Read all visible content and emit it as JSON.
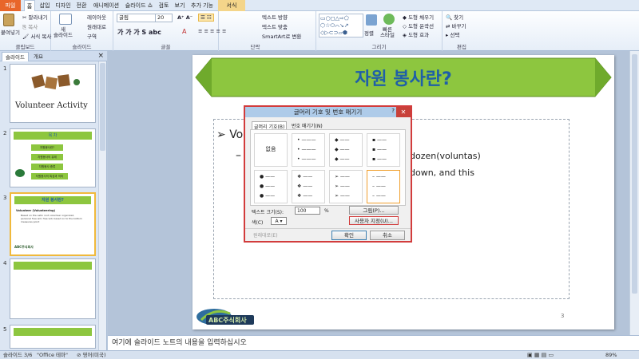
{
  "tabs": [
    {
      "label": "파일",
      "kind": "file"
    },
    {
      "label": "홈",
      "kind": "active"
    },
    {
      "label": "삽입",
      "kind": ""
    },
    {
      "label": "디자인",
      "kind": ""
    },
    {
      "label": "전환",
      "kind": ""
    },
    {
      "label": "애니메이션",
      "kind": ""
    },
    {
      "label": "슬라이드 쇼",
      "kind": ""
    },
    {
      "label": "검토",
      "kind": ""
    },
    {
      "label": "보기",
      "kind": ""
    },
    {
      "label": "추가 기능",
      "kind": ""
    },
    {
      "label": "서식",
      "kind": "context"
    }
  ],
  "ribbon": {
    "paste": "붙여넣기",
    "cut": "잘라내기",
    "copy": "복사",
    "format_painter": "서식 복사",
    "clipboard": "클립보드",
    "new_slide": "새\n슬라이드",
    "layout": "레이아웃",
    "reset": "원래대로",
    "section": "구역",
    "slides": "슬라이드",
    "font_name": "굴림",
    "font_size": "20",
    "font": "글꼴",
    "text_direction": "텍스트 방향",
    "align_text": "텍스트 맞춤",
    "smartart": "SmartArt로 변환",
    "paragraph": "단락",
    "arrange": "정렬",
    "quick_styles": "빠른\n스타일",
    "shape_fill": "도형 채우기",
    "shape_outline": "도형 윤곽선",
    "shape_effects": "도형 효과",
    "drawing": "그리기",
    "find": "찾기",
    "replace": "바꾸기",
    "select": "선택",
    "editing": "편집"
  },
  "left_panel": {
    "tab_slides": "슬라이드",
    "tab_outline": "개요",
    "close": "×",
    "slide_numbers": [
      "1",
      "2",
      "3",
      "4",
      "5"
    ],
    "thumb1_title": "Volunteer Activity",
    "thumb2_title": "목 차",
    "thumb2_items": [
      "자원봉사란?",
      "자원봉사의 유래",
      "자원봉사 종류",
      "자원봉사의 특성과 의미"
    ],
    "thumb3_title": "자원 봉사란?",
    "thumb3_bullet": "Volunteer (Volunteering)",
    "thumb3_sub": "Based on the Latin root volunteer organized, personal free will, free will, based on to the bottom measures point",
    "logo_text": "ABC주식회사"
  },
  "slide": {
    "title": "자원 봉사란?",
    "bullet_partial": "Vo",
    "sub_text1": "dozen(voluntas)",
    "sub_text2": "down, and this",
    "page_number": "3",
    "logo_text": "ABC주식회사"
  },
  "dialog": {
    "title": "글머리 기호 및 번호 매기기",
    "help": "?",
    "tab_bullets": "글머리 기호(B)",
    "tab_numbers": "번호 매기기(N)",
    "none_label": "없음",
    "text_size_label": "텍스트 크기(S):",
    "text_size_value": "100",
    "percent": "%",
    "color_label": "색(C)",
    "picture_button": "그림(P)...",
    "customize_button": "사용자 지정(U)...",
    "reset_button": "원래대로(E)",
    "ok_button": "확인",
    "cancel_button": "취소"
  },
  "notes": {
    "placeholder": "여기에 슬라이드 노트의 내용을 입력하십시오"
  },
  "status": {
    "slide_info": "슬라이드 3/6",
    "theme": "\"Office 테마\"",
    "language": "영어(미국)",
    "zoom": "89%"
  },
  "colors": {
    "title_green": "#8dc63f",
    "title_text": "#1f5fa8",
    "dialog_border": "#d23c3c",
    "selection": "#f0b93c"
  }
}
